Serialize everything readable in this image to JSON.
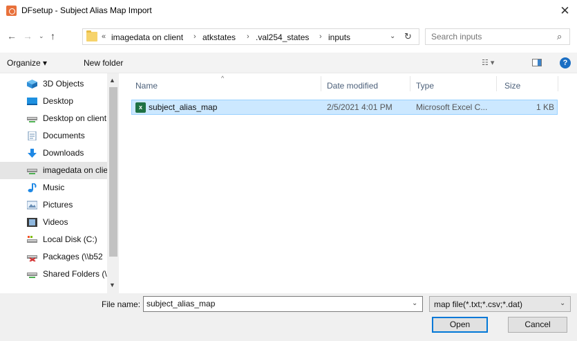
{
  "window": {
    "title": "DFsetup - Subject Alias Map Import",
    "close_glyph": "✕",
    "app_icon": "app-icon"
  },
  "nav_buttons": {
    "back": "←",
    "forward": "→",
    "recent": "⌄",
    "up": "↑"
  },
  "address": {
    "overflow": "«",
    "crumbs": [
      "imagedata on client",
      "atkstates",
      ".val254_states",
      "inputs"
    ],
    "separator": "›",
    "dropdown_glyph": "⌄",
    "refresh_glyph": "↻"
  },
  "search": {
    "placeholder": "Search inputs",
    "icon_glyph": "⌕"
  },
  "toolbar": {
    "organize_label": "Organize ▾",
    "new_folder_label": "New folder",
    "view_glyph": "☷ ▾",
    "help_glyph": "?"
  },
  "nav_pane": {
    "items": [
      {
        "label": "3D Objects",
        "icon": "3d-objects-icon"
      },
      {
        "label": "Desktop",
        "icon": "desktop-icon"
      },
      {
        "label": "Desktop on client",
        "icon": "network-drive-icon"
      },
      {
        "label": "Documents",
        "icon": "documents-icon"
      },
      {
        "label": "Downloads",
        "icon": "downloads-icon"
      },
      {
        "label": "imagedata on client",
        "icon": "network-drive-icon",
        "selected": true
      },
      {
        "label": "Music",
        "icon": "music-icon"
      },
      {
        "label": "Pictures",
        "icon": "pictures-icon"
      },
      {
        "label": "Videos",
        "icon": "videos-icon"
      },
      {
        "label": "Local Disk (C:)",
        "icon": "local-disk-icon"
      },
      {
        "label": "Packages (\\\\b52",
        "icon": "disconnected-drive-icon"
      },
      {
        "label": "Shared Folders (\\",
        "icon": "network-drive-icon"
      }
    ],
    "scroll_up": "▲",
    "scroll_down": "▼"
  },
  "file_list": {
    "columns": {
      "name": "Name",
      "date": "Date modified",
      "type": "Type",
      "size": "Size"
    },
    "sort_glyph": "^",
    "rows": [
      {
        "name": "subject_alias_map",
        "date": "2/5/2021 4:01 PM",
        "type": "Microsoft Excel C...",
        "size": "1 KB",
        "icon": "excel-csv-icon",
        "selected": true
      }
    ]
  },
  "footer": {
    "file_name_label": "File name:",
    "file_name_value": "subject_alias_map",
    "file_type": "map file(*.txt;*.csv;*.dat)",
    "dropdown_glyph": "⌄",
    "open_label": "Open",
    "cancel_label": "Cancel"
  },
  "colors": {
    "accent": "#0078d7",
    "selection": "#cce8ff",
    "excel_green": "#1f7244",
    "folder_yellow": "#f6d36b"
  }
}
